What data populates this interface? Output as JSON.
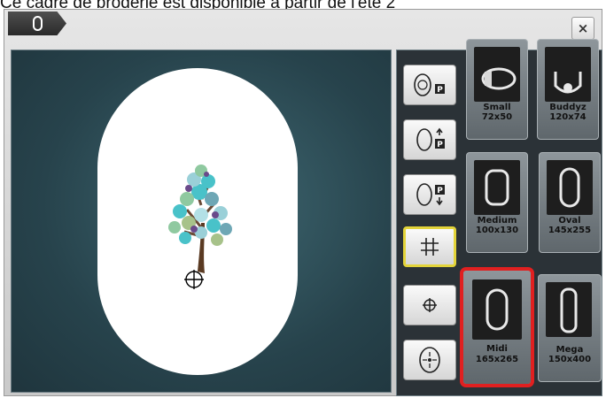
{
  "caption": "Ce cadre de broderie est disponible à partir de l'été 2",
  "header": {
    "close_label": "×"
  },
  "hoops": [
    {
      "name": "Small",
      "size": "72x50"
    },
    {
      "name": "Buddyz",
      "size": "120x74"
    },
    {
      "name": "Medium",
      "size": "100x130"
    },
    {
      "name": "Oval",
      "size": "145x255"
    },
    {
      "name": "Midi",
      "size": "165x265",
      "selected": true
    },
    {
      "name": "Mega",
      "size": "150x400"
    }
  ],
  "tools": [
    {
      "icon": "move-hoop-park-icon",
      "badge": "P"
    },
    {
      "icon": "hoop-park-up-icon",
      "badge": "P"
    },
    {
      "icon": "hoop-park-down-icon",
      "badge": "P"
    },
    {
      "icon": "grid-icon",
      "active": true
    },
    {
      "icon": "center-crosshair-icon"
    },
    {
      "icon": "move-center-icon"
    }
  ],
  "colors": {
    "selection": "#e02020",
    "active_tool": "#e3d43a",
    "stage": "#2b4a53"
  }
}
